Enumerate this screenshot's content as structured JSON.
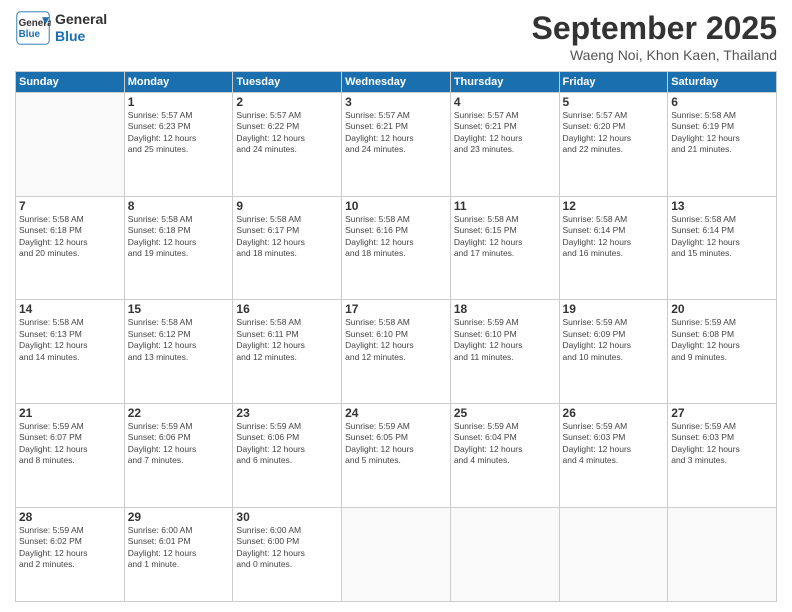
{
  "logo": {
    "line1": "General",
    "line2": "Blue"
  },
  "title": "September 2025",
  "subtitle": "Waeng Noi, Khon Kaen, Thailand",
  "weekdays": [
    "Sunday",
    "Monday",
    "Tuesday",
    "Wednesday",
    "Thursday",
    "Friday",
    "Saturday"
  ],
  "weeks": [
    [
      {
        "day": "",
        "info": ""
      },
      {
        "day": "1",
        "info": "Sunrise: 5:57 AM\nSunset: 6:23 PM\nDaylight: 12 hours\nand 25 minutes."
      },
      {
        "day": "2",
        "info": "Sunrise: 5:57 AM\nSunset: 6:22 PM\nDaylight: 12 hours\nand 24 minutes."
      },
      {
        "day": "3",
        "info": "Sunrise: 5:57 AM\nSunset: 6:21 PM\nDaylight: 12 hours\nand 24 minutes."
      },
      {
        "day": "4",
        "info": "Sunrise: 5:57 AM\nSunset: 6:21 PM\nDaylight: 12 hours\nand 23 minutes."
      },
      {
        "day": "5",
        "info": "Sunrise: 5:57 AM\nSunset: 6:20 PM\nDaylight: 12 hours\nand 22 minutes."
      },
      {
        "day": "6",
        "info": "Sunrise: 5:58 AM\nSunset: 6:19 PM\nDaylight: 12 hours\nand 21 minutes."
      }
    ],
    [
      {
        "day": "7",
        "info": "Sunrise: 5:58 AM\nSunset: 6:18 PM\nDaylight: 12 hours\nand 20 minutes."
      },
      {
        "day": "8",
        "info": "Sunrise: 5:58 AM\nSunset: 6:18 PM\nDaylight: 12 hours\nand 19 minutes."
      },
      {
        "day": "9",
        "info": "Sunrise: 5:58 AM\nSunset: 6:17 PM\nDaylight: 12 hours\nand 18 minutes."
      },
      {
        "day": "10",
        "info": "Sunrise: 5:58 AM\nSunset: 6:16 PM\nDaylight: 12 hours\nand 18 minutes."
      },
      {
        "day": "11",
        "info": "Sunrise: 5:58 AM\nSunset: 6:15 PM\nDaylight: 12 hours\nand 17 minutes."
      },
      {
        "day": "12",
        "info": "Sunrise: 5:58 AM\nSunset: 6:14 PM\nDaylight: 12 hours\nand 16 minutes."
      },
      {
        "day": "13",
        "info": "Sunrise: 5:58 AM\nSunset: 6:14 PM\nDaylight: 12 hours\nand 15 minutes."
      }
    ],
    [
      {
        "day": "14",
        "info": "Sunrise: 5:58 AM\nSunset: 6:13 PM\nDaylight: 12 hours\nand 14 minutes."
      },
      {
        "day": "15",
        "info": "Sunrise: 5:58 AM\nSunset: 6:12 PM\nDaylight: 12 hours\nand 13 minutes."
      },
      {
        "day": "16",
        "info": "Sunrise: 5:58 AM\nSunset: 6:11 PM\nDaylight: 12 hours\nand 12 minutes."
      },
      {
        "day": "17",
        "info": "Sunrise: 5:58 AM\nSunset: 6:10 PM\nDaylight: 12 hours\nand 12 minutes."
      },
      {
        "day": "18",
        "info": "Sunrise: 5:59 AM\nSunset: 6:10 PM\nDaylight: 12 hours\nand 11 minutes."
      },
      {
        "day": "19",
        "info": "Sunrise: 5:59 AM\nSunset: 6:09 PM\nDaylight: 12 hours\nand 10 minutes."
      },
      {
        "day": "20",
        "info": "Sunrise: 5:59 AM\nSunset: 6:08 PM\nDaylight: 12 hours\nand 9 minutes."
      }
    ],
    [
      {
        "day": "21",
        "info": "Sunrise: 5:59 AM\nSunset: 6:07 PM\nDaylight: 12 hours\nand 8 minutes."
      },
      {
        "day": "22",
        "info": "Sunrise: 5:59 AM\nSunset: 6:06 PM\nDaylight: 12 hours\nand 7 minutes."
      },
      {
        "day": "23",
        "info": "Sunrise: 5:59 AM\nSunset: 6:06 PM\nDaylight: 12 hours\nand 6 minutes."
      },
      {
        "day": "24",
        "info": "Sunrise: 5:59 AM\nSunset: 6:05 PM\nDaylight: 12 hours\nand 5 minutes."
      },
      {
        "day": "25",
        "info": "Sunrise: 5:59 AM\nSunset: 6:04 PM\nDaylight: 12 hours\nand 4 minutes."
      },
      {
        "day": "26",
        "info": "Sunrise: 5:59 AM\nSunset: 6:03 PM\nDaylight: 12 hours\nand 4 minutes."
      },
      {
        "day": "27",
        "info": "Sunrise: 5:59 AM\nSunset: 6:03 PM\nDaylight: 12 hours\nand 3 minutes."
      }
    ],
    [
      {
        "day": "28",
        "info": "Sunrise: 5:59 AM\nSunset: 6:02 PM\nDaylight: 12 hours\nand 2 minutes."
      },
      {
        "day": "29",
        "info": "Sunrise: 6:00 AM\nSunset: 6:01 PM\nDaylight: 12 hours\nand 1 minute."
      },
      {
        "day": "30",
        "info": "Sunrise: 6:00 AM\nSunset: 6:00 PM\nDaylight: 12 hours\nand 0 minutes."
      },
      {
        "day": "",
        "info": ""
      },
      {
        "day": "",
        "info": ""
      },
      {
        "day": "",
        "info": ""
      },
      {
        "day": "",
        "info": ""
      }
    ]
  ]
}
